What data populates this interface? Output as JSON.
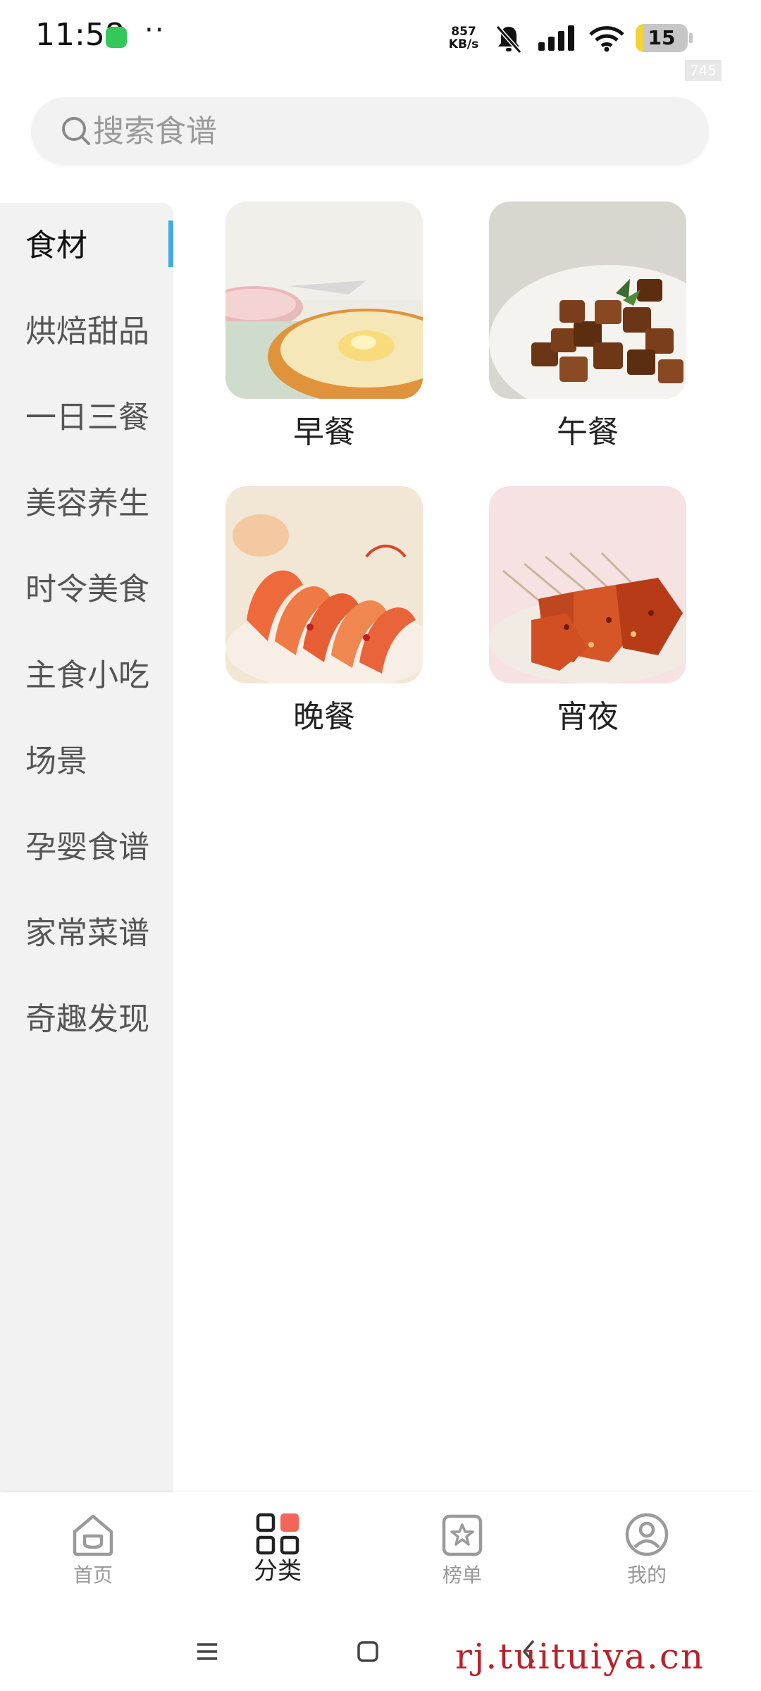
{
  "status_bar": {
    "time": "11:58",
    "more": "··",
    "net_speed_value": "857",
    "net_speed_unit": "KB/s",
    "battery_level": "15",
    "fps_badge": "745",
    "icons": [
      "app-notification-icon",
      "bell-off-icon",
      "signal-icon",
      "wifi-icon",
      "battery-icon"
    ]
  },
  "search": {
    "placeholder": "搜索食谱",
    "value": ""
  },
  "sidebar": {
    "active_index": 0,
    "items": [
      {
        "label": "食材"
      },
      {
        "label": "烘焙甜品"
      },
      {
        "label": "一日三餐"
      },
      {
        "label": "美容养生"
      },
      {
        "label": "时令美食"
      },
      {
        "label": "主食小吃"
      },
      {
        "label": "场景"
      },
      {
        "label": "孕婴食谱"
      },
      {
        "label": "家常菜谱"
      },
      {
        "label": "奇趣发现"
      }
    ]
  },
  "categories": [
    {
      "label": "早餐",
      "image": "toast-breakfast-photo"
    },
    {
      "label": "午餐",
      "image": "braised-meat-lunch-photo"
    },
    {
      "label": "晚餐",
      "image": "shrimp-dinner-photo"
    },
    {
      "label": "宵夜",
      "image": "skewers-late-night-photo"
    }
  ],
  "bottom_nav": {
    "active_index": 1,
    "items": [
      {
        "label": "首页",
        "icon": "home-icon"
      },
      {
        "label": "分类",
        "icon": "category-grid-icon"
      },
      {
        "label": "榜单",
        "icon": "ranking-star-icon"
      },
      {
        "label": "我的",
        "icon": "profile-icon"
      }
    ]
  },
  "system_nav": [
    "menu-icon",
    "home-square-icon",
    "back-icon"
  ],
  "watermark": "rj.tuituiya.cn",
  "colors": {
    "accent_indicator": "#45a9e8",
    "category_icon_accent": "#f2665a",
    "sidebar_bg": "#f2f2f2"
  }
}
